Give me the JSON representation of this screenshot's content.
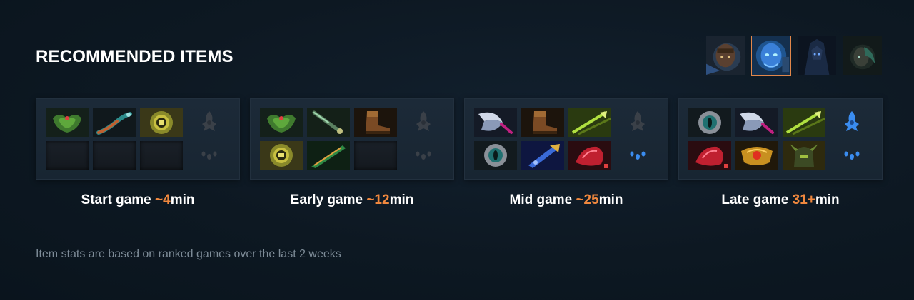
{
  "title": "RECOMMENDED ITEMS",
  "heroes": [
    {
      "icon": "hero-portrait-1-icon",
      "active": false
    },
    {
      "icon": "hero-portrait-2-icon",
      "active": true
    },
    {
      "icon": "hero-portrait-3-icon",
      "active": false
    },
    {
      "icon": "hero-portrait-4-icon",
      "active": false
    }
  ],
  "phases": [
    {
      "label": "Start game ",
      "time": "~4",
      "unit": "min",
      "items": [
        "orb-of-venom-icon",
        "tango-icon",
        "circlet-icon",
        "",
        "",
        ""
      ],
      "neutral_active": false,
      "neutral_slot_active": false
    },
    {
      "label": "Early game ",
      "time": "~12",
      "unit": "min",
      "items": [
        "orb-of-venom-icon",
        "magic-wand-icon",
        "boots-icon",
        "circlet-icon",
        "falcon-blade-icon",
        ""
      ],
      "neutral_active": false,
      "neutral_slot_active": false
    },
    {
      "label": "Mid game ",
      "time": "~25",
      "unit": "min",
      "items": [
        "diffusal-blade-icon",
        "boots-icon",
        "harpoon-icon",
        "eye-of-skadi-icon",
        "dagon-icon",
        "red-ammo-icon"
      ],
      "neutral_active": false,
      "neutral_slot_active": true
    },
    {
      "label": "Late game ",
      "time": "31+",
      "unit": "min",
      "items": [
        "eye-of-skadi-icon",
        "diffusal-blade-icon",
        "harpoon-icon",
        "red-ammo-icon",
        "golden-armor-icon",
        "helm-icon"
      ],
      "neutral_active": true,
      "neutral_slot_active": true
    }
  ],
  "note": "Item stats are based on ranked games over the last 2 weeks",
  "colors": {
    "accent": "#f0883e",
    "active_border": "#e2874a",
    "neutral_blue": "#3a8cf0"
  }
}
